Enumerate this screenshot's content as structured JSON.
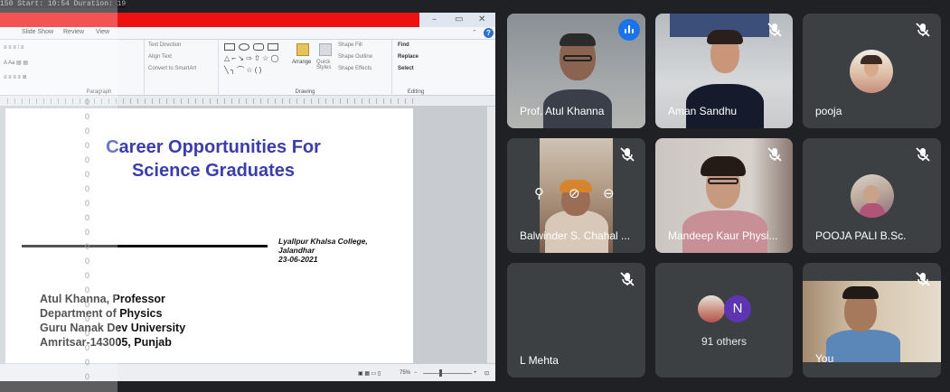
{
  "overlay": {
    "text": "150  Start: 10:54  Duration: 19"
  },
  "ppt": {
    "menu": [
      "Slide Show",
      "Review",
      "View"
    ],
    "ribbon": {
      "text_direction": "Text Direction",
      "align_text": "Align Text",
      "convert": "Convert to SmartArt",
      "paragraph": "Paragraph",
      "drawing": "Drawing",
      "arrange": "Arrange",
      "quick_styles": "Quick Styles",
      "shape_fill": "Shape Fill",
      "shape_outline": "Shape Outline",
      "shape_effects": "Shape Effects",
      "find": "Find",
      "replace": "Replace",
      "select": "Select",
      "editing": "Editing"
    },
    "zoom": "75%"
  },
  "slide": {
    "title_line1": "Career Opportunities For",
    "title_line2": "Science Graduates",
    "college_line1": "Lyallpur Khalsa College,",
    "college_line2": "Jalandhar",
    "college_line3": "23-06-2021",
    "author_line1": "Atul Khanna, Professor",
    "author_line2": "Department of Physics",
    "author_line3": "Guru Nanak Dev University",
    "author_line4": "Amritsar-143005, Punjab"
  },
  "participants": [
    {
      "name": "Prof. Atul Khanna",
      "speaking": true
    },
    {
      "name": "Aman Sandhu",
      "muted": true
    },
    {
      "name": "pooja",
      "muted": true
    },
    {
      "name": "Balwinder S. Chahal ...",
      "muted": true
    },
    {
      "name": "Mandeep Kaur Physi...",
      "muted": true
    },
    {
      "name": "POOJA PALI B.Sc.",
      "muted": true
    },
    {
      "name": "L Mehta",
      "muted": true
    },
    {
      "others": "91 others",
      "initial": "N"
    },
    {
      "name": "You",
      "muted": true
    }
  ],
  "colors": {
    "bg": "#202124",
    "tile": "#3c4043",
    "active": "#8ab4f8",
    "speak": "#1a73e8",
    "slide_title": "#3b3dab"
  }
}
